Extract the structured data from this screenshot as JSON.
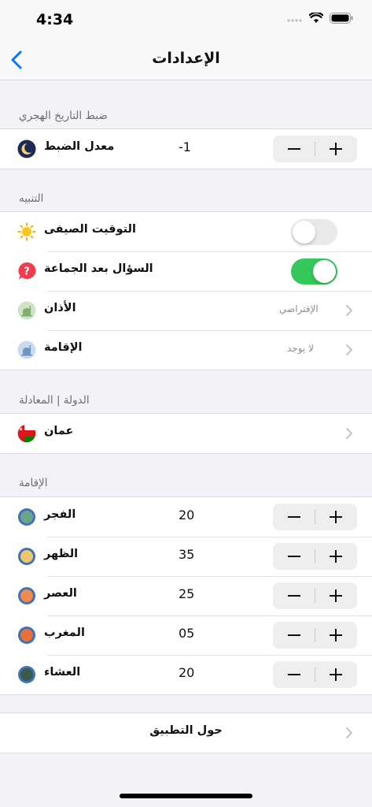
{
  "status_bar": {
    "time": "4:34"
  },
  "nav": {
    "title": "الإعدادات"
  },
  "sections": {
    "hijri": {
      "header": "ضبط التاريخ الهجري",
      "adjust": {
        "label": "معدل الضبط",
        "value": "-1"
      }
    },
    "alerts": {
      "header": "التنبيه",
      "summer_time": {
        "label": "التوقيت الصيفى",
        "on": false
      },
      "ask_after_jamaa": {
        "label": "السؤال بعد الجماعة",
        "on": true
      },
      "adhan": {
        "label": "الأذان",
        "detail": "الإفتراضي"
      },
      "iqama": {
        "label": "الإقامة",
        "detail": "لا يوجد"
      }
    },
    "country": {
      "header": "الدولة | المعادلة",
      "country": {
        "label": "عمان"
      }
    },
    "iqama": {
      "header": "الإقامة",
      "prayers": [
        {
          "label": "الفجر",
          "value": "20",
          "color": "#6aa58a"
        },
        {
          "label": "الظهر",
          "value": "35",
          "color": "#f0c66b"
        },
        {
          "label": "العصر",
          "value": "25",
          "color": "#f08a4f"
        },
        {
          "label": "المغرب",
          "value": "05",
          "color": "#e8703b"
        },
        {
          "label": "العشاء",
          "value": "20",
          "color": "#3c5a4c"
        }
      ]
    },
    "about": {
      "label": "حول التطبيق"
    }
  },
  "icons": {
    "moon": "moon-icon",
    "sun": "sun-icon",
    "question": "question-icon",
    "mosque": "mosque-icon",
    "flag": "oman-flag-icon"
  },
  "colors": {
    "accent": "#007aff",
    "toggle_on": "#34c759",
    "question_badge": "#f23b4f"
  }
}
